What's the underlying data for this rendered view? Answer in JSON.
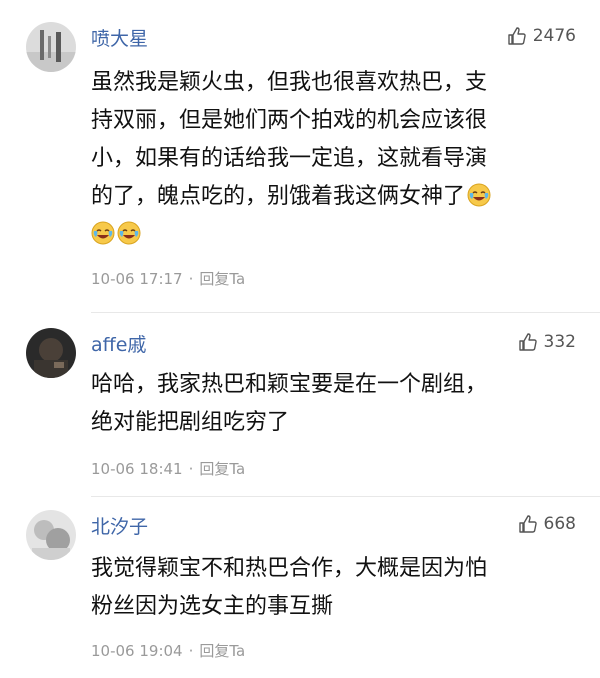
{
  "comments": [
    {
      "username": "喷大星",
      "likes": "2476",
      "lines": [
        "虽然我是颖火虫，但我也很喜欢热巴，支",
        "持双丽，但是她们两个拍戏的机会应该很",
        "小，如果有的话给我一定追，这就看导演",
        "的了，魄点吃的，别饿着我这俩女神了"
      ],
      "emoji_icon": "crying-laughing-emoji-icon",
      "timestamp": "10-06 17:17",
      "separator": "·",
      "reply_label": "回复Ta"
    },
    {
      "username": "affe戚",
      "likes": "332",
      "lines": [
        "哈哈，我家热巴和颖宝要是在一个剧组，",
        "绝对能把剧组吃穷了"
      ],
      "timestamp": "10-06 18:41",
      "separator": "·",
      "reply_label": "回复Ta"
    },
    {
      "username": "北汐子",
      "likes": "668",
      "lines": [
        "我觉得颖宝不和热巴合作，大概是因为怕",
        "粉丝因为选女主的事互撕"
      ],
      "timestamp": "10-06 19:04",
      "separator": "·",
      "reply_label": "回复Ta"
    }
  ],
  "colors": {
    "username": "#3f66a8",
    "meta": "#9a9a9a",
    "body": "#111111",
    "divider": "#e8e8e8"
  }
}
